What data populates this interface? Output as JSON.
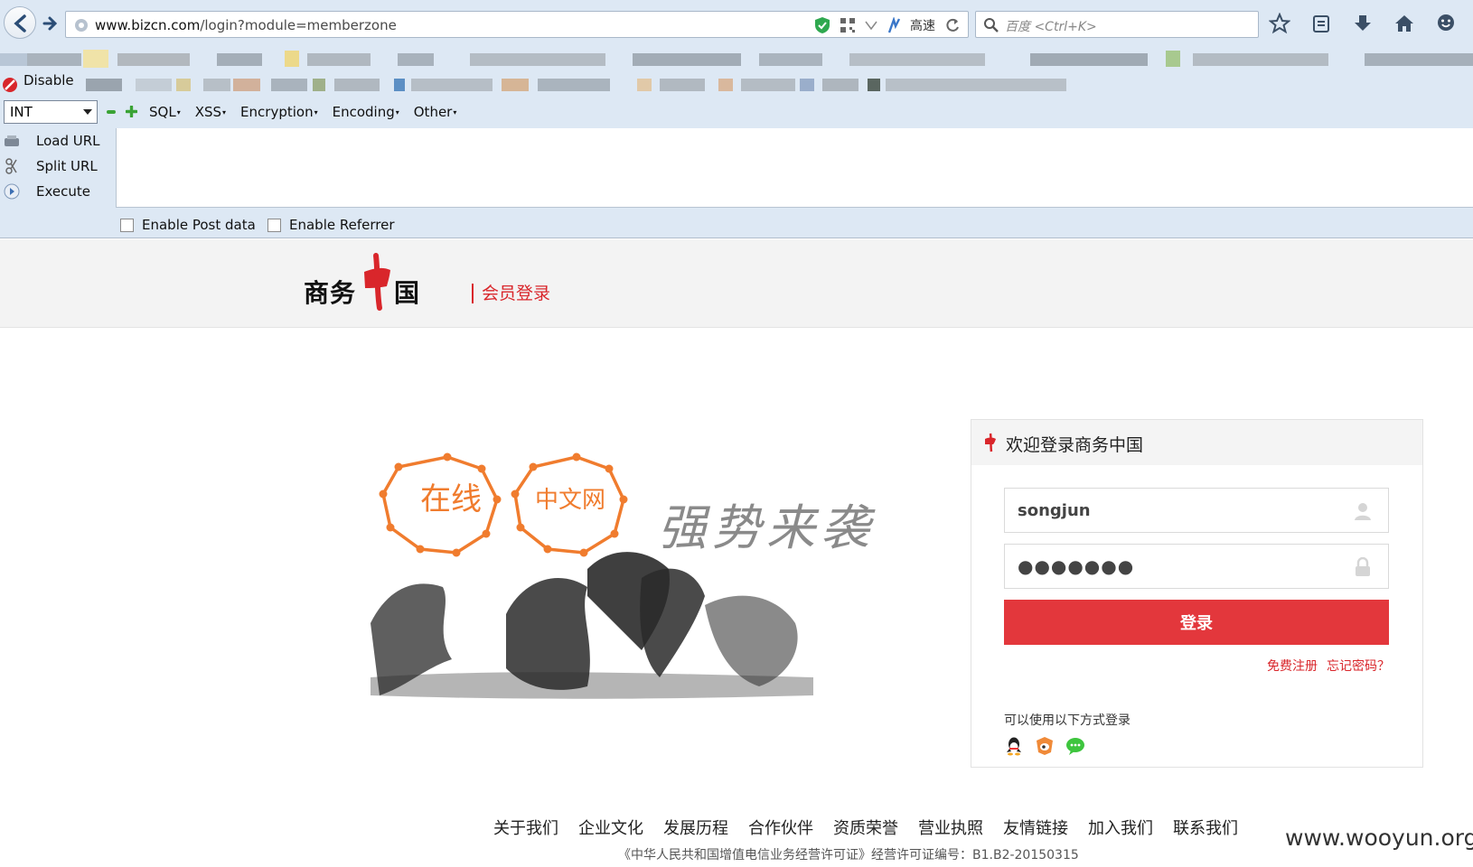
{
  "browser": {
    "url_host": "www.bizcn.com",
    "url_path": "/login?module=memberzone",
    "speed_label": "高速",
    "search_placeholder": "百度 <Ctrl+K>",
    "bookmark_visible_label": "Disable"
  },
  "hackbar": {
    "type_select": "INT",
    "menus": [
      "SQL",
      "XSS",
      "Encryption",
      "Encoding",
      "Other"
    ],
    "actions": [
      {
        "label": "Load URL",
        "icon": "load-url-icon"
      },
      {
        "label": "Split URL",
        "icon": "split-url-icon"
      },
      {
        "label": "Execute",
        "icon": "execute-icon"
      }
    ],
    "options": [
      {
        "label": "Enable Post data",
        "checked": false
      },
      {
        "label": "Enable Referrer",
        "checked": false
      }
    ]
  },
  "site": {
    "logo_text": "商务中国",
    "logo_left": "商务",
    "logo_right": "国",
    "section_label": "会员登录",
    "hero": {
      "badge1": "在线",
      "badge2": "中文网",
      "slogan": "强势来袭",
      "accent": "#f07c2e"
    }
  },
  "login": {
    "title": "欢迎登录商务中国",
    "username": "songjun",
    "password_mask": "●●●●●●●",
    "submit_label": "登录",
    "register_link": "免费注册",
    "forgot_link": "忘记密码？",
    "alt_label": "可以使用以下方式登录",
    "alt_methods": [
      "qq-icon",
      "weibo-icon",
      "wechat-icon"
    ],
    "brand_color": "#e3373c"
  },
  "footer": {
    "links": [
      "关于我们",
      "企业文化",
      "发展历程",
      "合作伙伴",
      "资质荣誉",
      "营业执照",
      "友情链接",
      "加入我们",
      "联系我们"
    ],
    "license": "《中华人民共和国增值电信业务经营许可证》经营许可证编号：B1.B2-20150315"
  },
  "watermark": "www.wooyun.org"
}
